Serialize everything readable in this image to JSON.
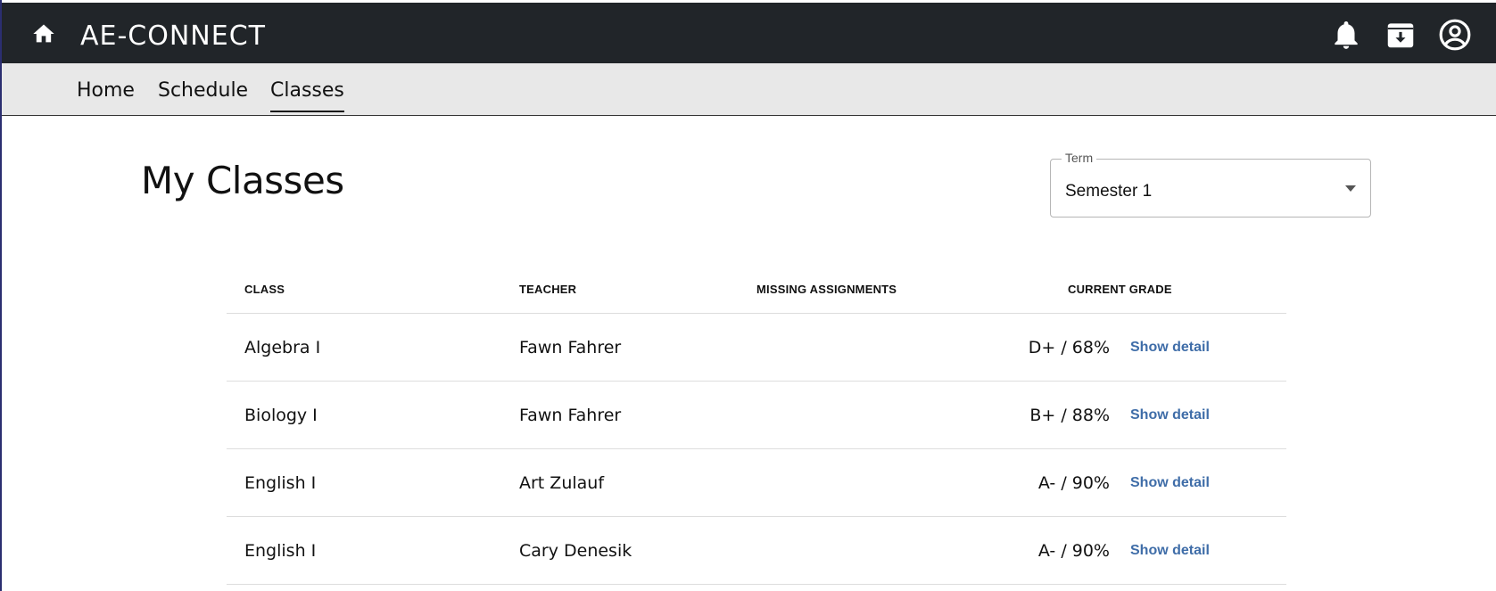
{
  "app": {
    "title": "AE-CONNECT"
  },
  "icons": {
    "home": "home-icon",
    "bell": "bell-icon",
    "download": "download-box-icon",
    "account": "account-circle-icon"
  },
  "nav": {
    "items": [
      {
        "label": "Home"
      },
      {
        "label": "Schedule"
      },
      {
        "label": "Classes"
      }
    ],
    "active": "Classes"
  },
  "page": {
    "title": "My Classes"
  },
  "term": {
    "label": "Term",
    "value": "Semester 1"
  },
  "table": {
    "headers": {
      "class": "CLASS",
      "teacher": "TEACHER",
      "missing": "MISSING ASSIGNMENTS",
      "grade": "CURRENT GRADE"
    },
    "rows": [
      {
        "class": "Algebra I",
        "teacher": "Fawn Fahrer",
        "missing": "",
        "grade": "D+ / 68%",
        "action": "Show detail"
      },
      {
        "class": "Biology I",
        "teacher": "Fawn Fahrer",
        "missing": "",
        "grade": "B+ / 88%",
        "action": "Show detail"
      },
      {
        "class": "English I",
        "teacher": "Art Zulauf",
        "missing": "",
        "grade": "A- / 90%",
        "action": "Show detail"
      },
      {
        "class": "English I",
        "teacher": "Cary Denesik",
        "missing": "",
        "grade": "A- / 90%",
        "action": "Show detail"
      }
    ]
  },
  "colors": {
    "topbar": "#212529",
    "subnav": "#e8e8e8",
    "link": "#3f6da8"
  }
}
